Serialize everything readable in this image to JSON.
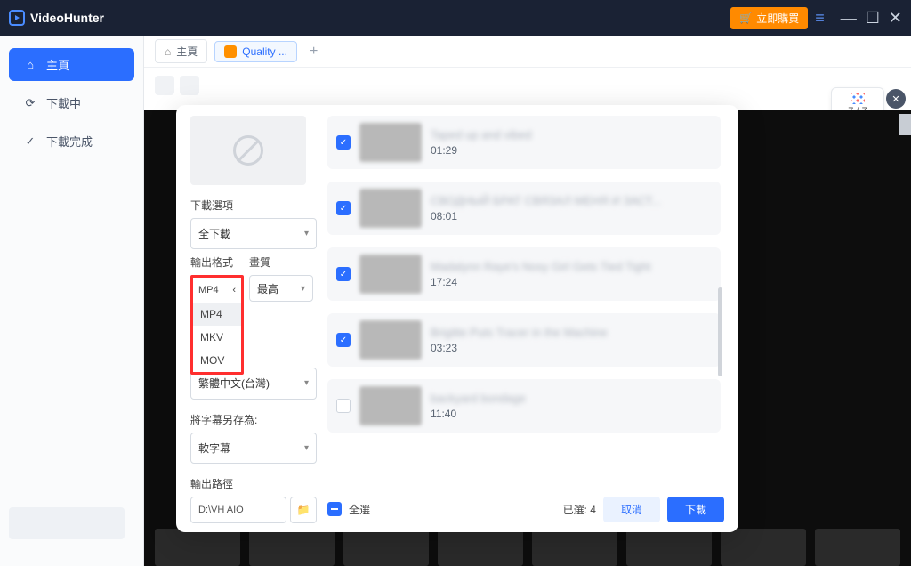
{
  "titlebar": {
    "app_name": "VideoHunter",
    "buy_label": "立即購買"
  },
  "sidebar": {
    "items": [
      {
        "label": "主頁"
      },
      {
        "label": "下載中"
      },
      {
        "label": "下載完成"
      }
    ]
  },
  "tabs": {
    "home": "主頁",
    "active": "Quality ...",
    "add": "+"
  },
  "counter": "7 / 7",
  "modal": {
    "opt_download": "下載選項",
    "opt_download_val": "全下載",
    "opt_format": "輸出格式",
    "opt_quality": "畫質",
    "format_val": "MP4",
    "quality_val": "最高",
    "format_options": [
      "MP4",
      "MKV",
      "MOV"
    ],
    "lang_val": "繁體中文(台灣)",
    "sub_label": "將字幕另存為:",
    "sub_val": "軟字幕",
    "path_label": "輸出路徑",
    "path_val": "D:\\VH AIO",
    "select_all": "全選",
    "selected_label": "已選:",
    "selected_count": "4",
    "cancel": "取消",
    "download": "下載",
    "items": [
      {
        "title": "Taped up and vibed",
        "dur": "01:29",
        "checked": true
      },
      {
        "title": "СВОДНЫЙ БРАТ СВЯЗАЛ МЕНЯ И ЗАСТ...",
        "dur": "08:01",
        "checked": true
      },
      {
        "title": "Madalynn Raye's Nosy Girl Gets Tied Tight",
        "dur": "17:24",
        "checked": true
      },
      {
        "title": "Brigitte Puts Tracer in the Machine",
        "dur": "03:23",
        "checked": true
      },
      {
        "title": "backyard bondage",
        "dur": "11:40",
        "checked": false
      }
    ]
  }
}
